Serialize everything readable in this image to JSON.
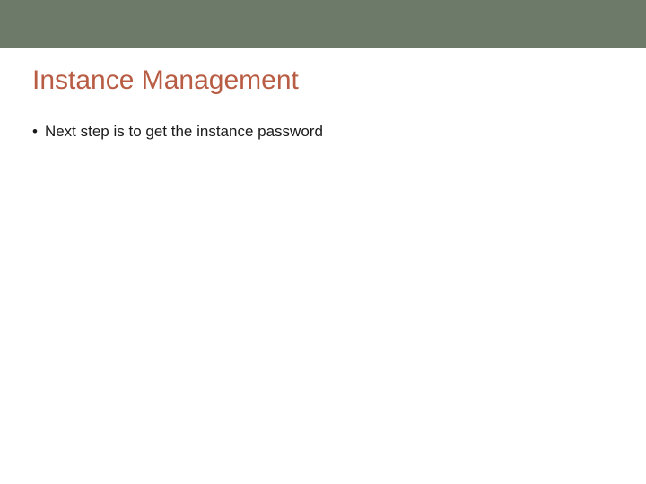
{
  "colors": {
    "topbar": "#6d7a6a",
    "title": "#b85c44"
  },
  "slide": {
    "title": "Instance Management",
    "bullets": [
      {
        "text": "Next step is to get the instance password"
      }
    ]
  }
}
